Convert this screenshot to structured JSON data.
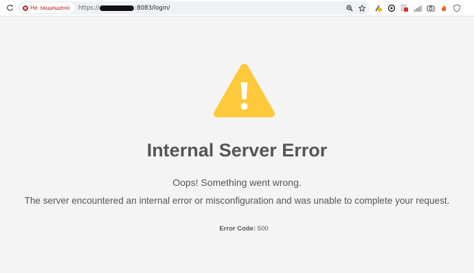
{
  "browser": {
    "security_label": "Не защищено",
    "url_scheme": "https://",
    "url_tail": ":8083/login/"
  },
  "page": {
    "title": "Internal Server Error",
    "subtitle": "Oops! Something went wrong.",
    "message": "The server encountered an internal error or misconfiguration and was unable to complete your request.",
    "error_code_label": "Error Code:",
    "error_code_value": "500"
  },
  "icons": {
    "warning": "warning-triangle-icon",
    "accent_color": "#ffc93c"
  }
}
